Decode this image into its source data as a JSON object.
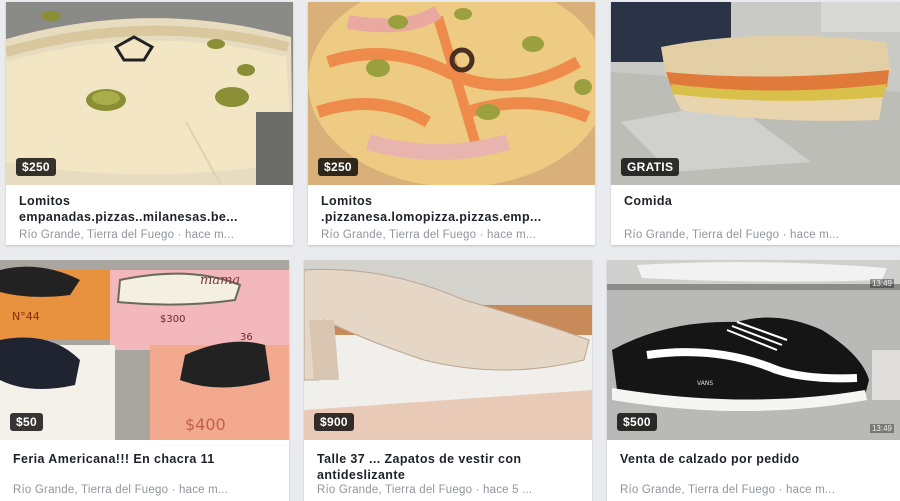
{
  "listings": [
    {
      "price": "$250",
      "title": "Lomitos empanadas.pizzas..milanesas.be...",
      "location": "Río Grande, Tierra del Fuego · hace m..."
    },
    {
      "price": "$250",
      "title": "Lomitos .pizzanesa.lomopizza.pizzas.emp...",
      "location": "Río Grande, Tierra del Fuego · hace m..."
    },
    {
      "price": "GRATIS",
      "title": "Comida",
      "location": "Río Grande, Tierra del Fuego · hace m..."
    },
    {
      "price": "$50",
      "title": "Feria Americana!!! En chacra 11",
      "location": "Río Grande, Tierra del Fuego · hace m..."
    },
    {
      "price": "$900",
      "title": "Talle 37 ... Zapatos de vestir con antideslizante",
      "location": "Río Grande, Tierra del Fuego · hace 5 ..."
    },
    {
      "price": "$500",
      "title": "Venta de calzado por pedido",
      "location": "Río Grande, Tierra del Fuego · hace m...",
      "timestamp_top": "13:49",
      "timestamp_bottom": "13:49"
    }
  ],
  "photo_text": {
    "box_label": "N°44",
    "box_brand": "mama",
    "box_price": "$300",
    "box_size": "36",
    "box_price_2": "$400",
    "shoe_brand": "VANS"
  }
}
